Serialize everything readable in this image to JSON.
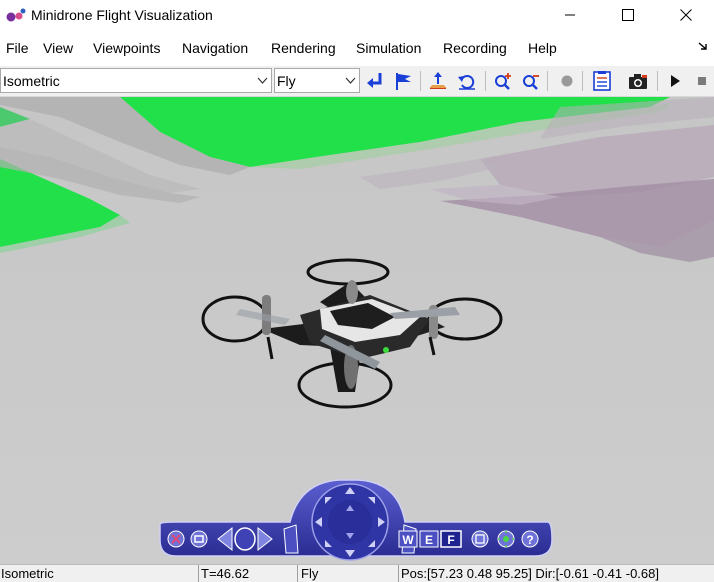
{
  "window": {
    "title": "Minidrone Flight Visualization"
  },
  "menu": {
    "items": [
      "File",
      "View",
      "Viewpoints",
      "Navigation",
      "Rendering",
      "Simulation",
      "Recording",
      "Help"
    ]
  },
  "toolbar": {
    "viewpoint_value": "Isometric",
    "navigation_mode_value": "Fly",
    "buttons": [
      "return-icon",
      "flag-icon",
      "straighten-icon",
      "undo-move-icon",
      "zoom-in-icon",
      "zoom-out-icon",
      "record-icon",
      "capture-list-icon",
      "camera-icon",
      "play-icon",
      "stop-icon"
    ]
  },
  "navpanel": {
    "mode_buttons": [
      "W",
      "E",
      "F"
    ]
  },
  "status": {
    "viewpoint": "Isometric",
    "time": "T=46.62",
    "mode": "Fly",
    "position": "Pos:[57.23 0.48 95.25] Dir:[-0.61 -0.41 -0.68]"
  },
  "colors": {
    "grass": "#22e04a",
    "ground": "#c8c8c8",
    "road_shade": "#a58fa6",
    "navpanel": "#3538a8",
    "accent_blue": "#1a3fd6"
  }
}
